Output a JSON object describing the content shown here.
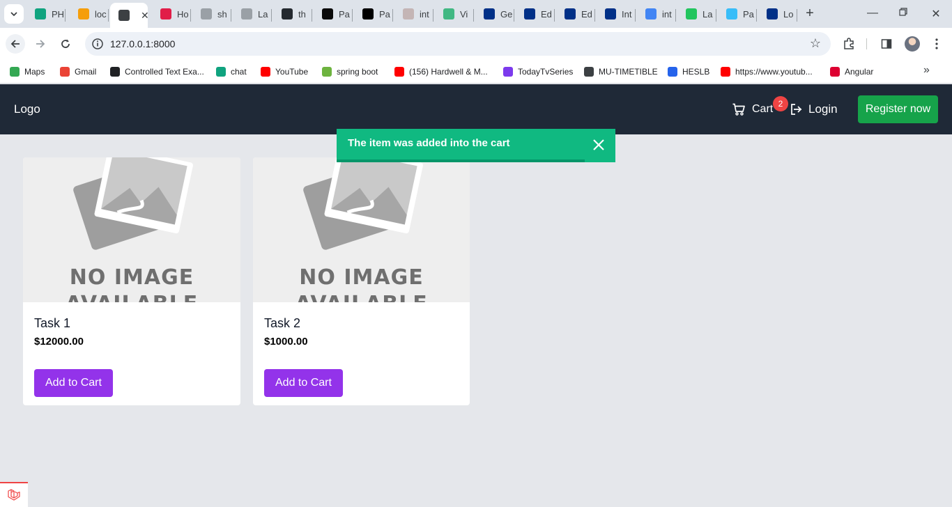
{
  "browser": {
    "tabs": [
      {
        "label": "PH",
        "color": "#10a37f"
      },
      {
        "label": "loc",
        "color": "#f59e0b"
      },
      {
        "label": "",
        "color": "#3c4043",
        "active": true
      },
      {
        "label": "Ho",
        "color": "#e11d48"
      },
      {
        "label": "sh",
        "color": "#9aa0a6"
      },
      {
        "label": "La",
        "color": "#9aa0a6"
      },
      {
        "label": "th",
        "color": "#24292f"
      },
      {
        "label": "Pa",
        "color": "#0a0a0a"
      },
      {
        "label": "Pa",
        "color": "#000000"
      },
      {
        "label": "int",
        "color": "#c4b5b5"
      },
      {
        "label": "Vi",
        "color": "#41b883"
      },
      {
        "label": "Ge",
        "color": "#003087"
      },
      {
        "label": "Ed",
        "color": "#003087"
      },
      {
        "label": "Ed",
        "color": "#003087"
      },
      {
        "label": "Int",
        "color": "#003087"
      },
      {
        "label": "int",
        "color": "#4285f4"
      },
      {
        "label": "La",
        "color": "#22c55e"
      },
      {
        "label": "Pa",
        "color": "#38bdf8"
      },
      {
        "label": "Lo",
        "color": "#003087"
      }
    ],
    "url": "127.0.0.1:8000",
    "bookmarks": [
      {
        "label": "Maps",
        "color": "#34a853"
      },
      {
        "label": "Gmail",
        "color": "#ea4335"
      },
      {
        "label": "Controlled Text Exa...",
        "color": "#202124"
      },
      {
        "label": "chat",
        "color": "#10a37f"
      },
      {
        "label": "YouTube",
        "color": "#ff0000"
      },
      {
        "label": "spring boot",
        "color": "#6db33f"
      },
      {
        "label": "(156) Hardwell & M...",
        "color": "#ff0000"
      },
      {
        "label": "TodayTvSeries",
        "color": "#7c3aed"
      },
      {
        "label": "MU-TIMETIBLE",
        "color": "#3c4043"
      },
      {
        "label": "HESLB",
        "color": "#2563eb"
      },
      {
        "label": "https://www.youtub...",
        "color": "#ff0000"
      },
      {
        "label": "Angular",
        "color": "#dd0031"
      }
    ]
  },
  "nav": {
    "logo": "Logo",
    "cart_label": "Cart",
    "cart_count": "2",
    "login_label": "Login",
    "register_label": "Register now"
  },
  "toast": {
    "message": "The item was added into the cart",
    "progress": 0.89
  },
  "products": [
    {
      "name": "Task 1",
      "price": "$12000.00",
      "button": "Add to Cart",
      "placeholder_line1": "NO IMAGE",
      "placeholder_line2": "AVAILABLE"
    },
    {
      "name": "Task 2",
      "price": "$1000.00",
      "button": "Add to Cart",
      "placeholder_line1": "NO IMAGE",
      "placeholder_line2": "AVAILABLE"
    }
  ],
  "colors": {
    "nav_bg": "#1f2937",
    "toast_bg": "#10b981",
    "register_bg": "#16a34a",
    "add_button_bg": "#9333ea",
    "badge_bg": "#ef4444"
  }
}
